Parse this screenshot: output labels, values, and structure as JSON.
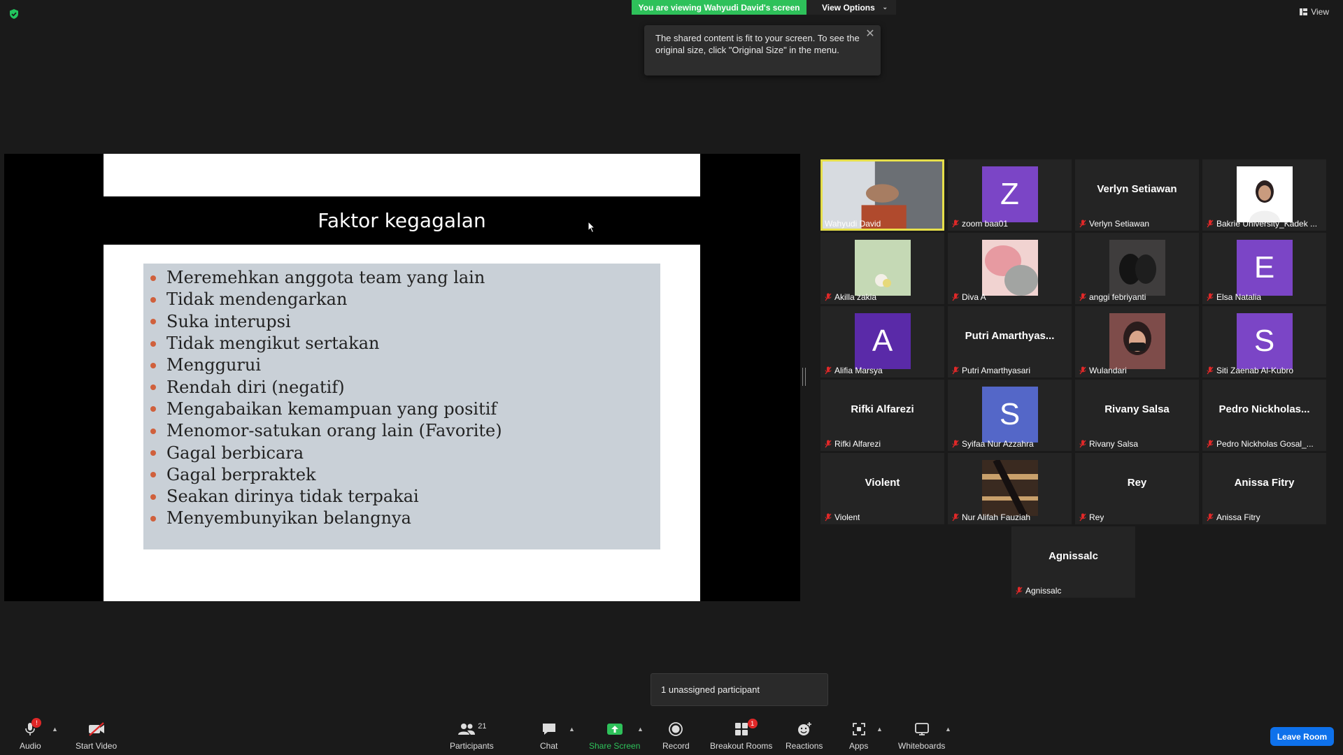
{
  "top": {
    "viewing_banner": "You are viewing Wahyudi David's screen",
    "view_options": "View Options",
    "tooltip": "The shared content is fit to your screen. To see the original size, click \"Original Size\" in the menu.",
    "view_label": "View"
  },
  "slide": {
    "title": "Faktor kegagalan",
    "bullets": [
      "Meremehkan anggota team yang lain",
      "Tidak mendengarkan",
      "Suka interupsi",
      "Tidak mengikut sertakan",
      "Menggurui",
      "Rendah diri (negatif)",
      "Mengabaikan kemampuan yang positif",
      "Menomor-satukan orang lain (Favorite)",
      "Gagal berbicara",
      "Gagal berpraktek",
      "Seakan dirinya tidak terpakai",
      "Menyembunyikan belangnya"
    ]
  },
  "gallery": [
    {
      "name": "Wahyudi David",
      "type": "video"
    },
    {
      "name": "zoom baa01",
      "type": "avatar",
      "letter": "Z",
      "color": "#7b45c6"
    },
    {
      "name": "Verlyn Setiawan",
      "type": "text",
      "display": "Verlyn Setiawan"
    },
    {
      "name": "Bakrie University_Kadek ...",
      "type": "photo"
    },
    {
      "name": "Akilla zakia",
      "type": "photo"
    },
    {
      "name": "Diva A",
      "type": "photo"
    },
    {
      "name": "anggi febriyanti",
      "type": "photo"
    },
    {
      "name": "Elsa Natalia",
      "type": "avatar",
      "letter": "E",
      "color": "#7b45c6"
    },
    {
      "name": "Alifia Marsya",
      "type": "avatar",
      "letter": "A",
      "color": "#5a2aa8"
    },
    {
      "name": "Putri Amarthyasari",
      "type": "text",
      "display": "Putri  Amarthyas..."
    },
    {
      "name": "Wulandari",
      "type": "photo"
    },
    {
      "name": "Siti Zaenab Al-Kubro",
      "type": "avatar",
      "letter": "S",
      "color": "#7b45c6"
    },
    {
      "name": "Rifki Alfarezi",
      "type": "text",
      "display": "Rifki Alfarezi"
    },
    {
      "name": "Syifaa Nur Azzahra",
      "type": "avatar",
      "letter": "S",
      "color": "#5467c8"
    },
    {
      "name": "Rivany Salsa",
      "type": "text",
      "display": "Rivany Salsa"
    },
    {
      "name": "Pedro Nickholas Gosal_...",
      "type": "text",
      "display": "Pedro  Nickholas..."
    },
    {
      "name": "Violent",
      "type": "text",
      "display": "Violent"
    },
    {
      "name": "Nur Alifah Fauziah",
      "type": "photo"
    },
    {
      "name": "Rey",
      "type": "text",
      "display": "Rey"
    },
    {
      "name": "Anissa Fitry",
      "type": "text",
      "display": "Anissa Fitry"
    },
    {
      "name": "Agnissalc",
      "type": "text",
      "display": "Agnissalc"
    }
  ],
  "popup": {
    "unassigned": "1 unassigned participant"
  },
  "toolbar": {
    "audio": "Audio",
    "audio_badge": "!",
    "start_video": "Start Video",
    "participants": "Participants",
    "participants_count": "21",
    "chat": "Chat",
    "share_screen": "Share Screen",
    "record": "Record",
    "breakout_rooms": "Breakout Rooms",
    "breakout_badge": "1",
    "reactions": "Reactions",
    "apps": "Apps",
    "whiteboards": "Whiteboards",
    "leave_room": "Leave Room"
  },
  "colors": {
    "banner_green": "#2ec15a",
    "active_speaker": "#e6df4a",
    "share_green": "#2ec15a",
    "leave_blue": "#0e71eb",
    "mic_off_red": "#e02828"
  }
}
